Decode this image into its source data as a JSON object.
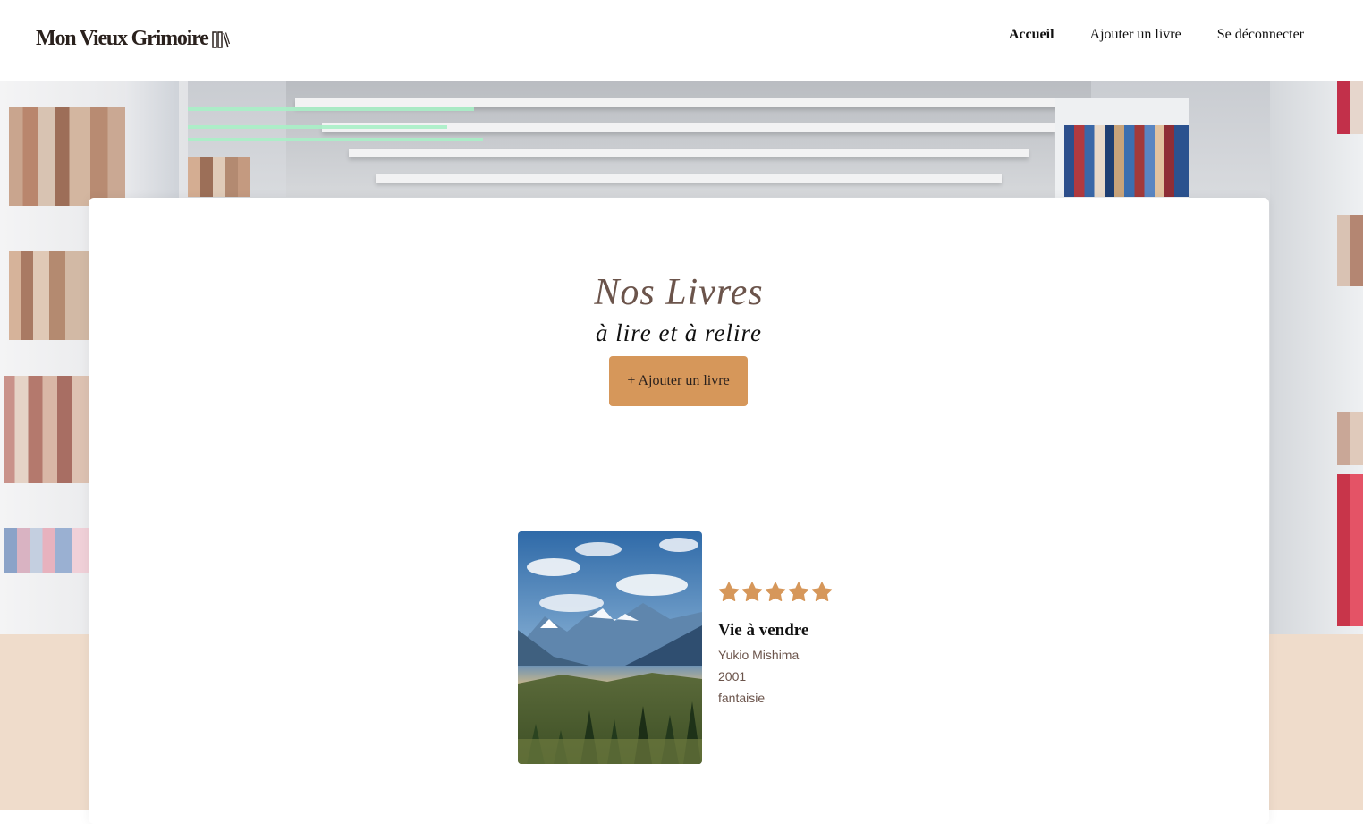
{
  "header": {
    "logo": "Mon Vieux Grimoire",
    "nav": [
      {
        "label": "Accueil",
        "active": true
      },
      {
        "label": "Ajouter un livre",
        "active": false
      },
      {
        "label": "Se déconnecter",
        "active": false
      }
    ]
  },
  "main": {
    "title": "Nos Livres",
    "subtitle": "à lire et à relire",
    "add_button": "+ Ajouter un livre"
  },
  "books": [
    {
      "title": "Vie à vendre",
      "author": "Yukio Mishima",
      "year": "2001",
      "genre": "fantaisie",
      "rating": 5,
      "max_rating": 5,
      "cover_icon": "mountain-landscape-image"
    }
  ],
  "colors": {
    "accent": "#d6975a",
    "title_brown": "#6b544b",
    "beige_band": "#efdccb"
  }
}
